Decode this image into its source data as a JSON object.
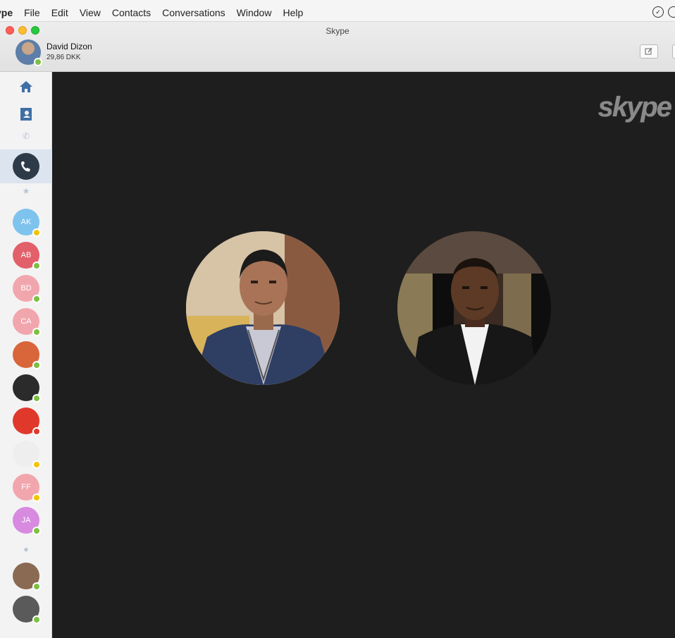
{
  "menubar": {
    "items": [
      "ype",
      "File",
      "Edit",
      "View",
      "Contacts",
      "Conversations",
      "Window",
      "Help"
    ]
  },
  "window": {
    "title": "Skype"
  },
  "profile": {
    "name": "David Dizon",
    "credit": "29,86 DKK",
    "status_color": "#7bc043"
  },
  "logo_text": "skype",
  "sidebar": {
    "contacts": [
      {
        "initials": "AK",
        "bg": "#7ec3ee",
        "status": "#f5c400"
      },
      {
        "initials": "AB",
        "bg": "#e2606a",
        "status": "#7bc043"
      },
      {
        "initials": "BD",
        "bg": "#f1a6ad",
        "status": "#7bc043"
      },
      {
        "initials": "CA",
        "bg": "#f1a6ad",
        "status": "#7bc043"
      },
      {
        "initials": "",
        "bg": "#d9653a",
        "status": "#7bc043"
      },
      {
        "initials": "",
        "bg": "#2b2b2b",
        "status": "#7bc043"
      },
      {
        "initials": "",
        "bg": "#e0392b",
        "status": "#e0392b"
      },
      {
        "initials": "",
        "bg": "#eeeeee",
        "status": "#f5c400"
      },
      {
        "initials": "FF",
        "bg": "#f1a6ad",
        "status": "#f5c400"
      },
      {
        "initials": "JA",
        "bg": "#d78ae0",
        "status": "#7bc043"
      },
      {
        "initials": "",
        "bg": "#8a6a52",
        "status": "#7bc043"
      },
      {
        "initials": "",
        "bg": "#5a5a5a",
        "status": "#7bc043"
      }
    ]
  },
  "colors": {
    "accent": "#3f6fa6",
    "call_bg": "#1e1e1e",
    "online": "#7bc043",
    "away": "#f5c400",
    "busy": "#e0392b"
  }
}
